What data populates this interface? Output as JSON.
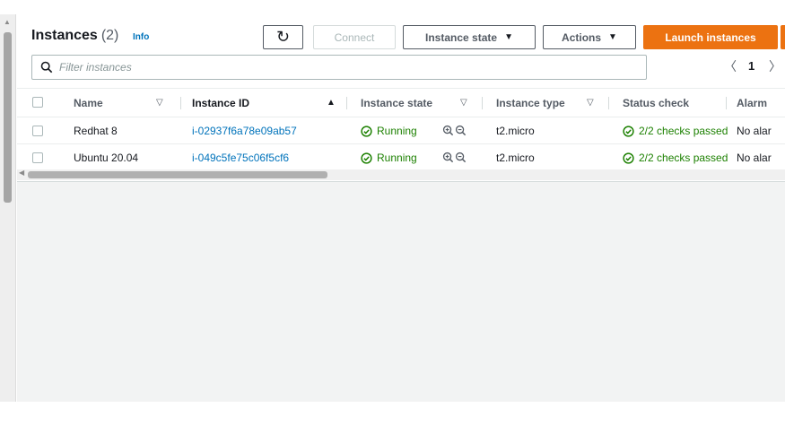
{
  "header": {
    "title": "Instances",
    "count": "(2)",
    "info": "Info"
  },
  "toolbar": {
    "refresh_icon": "refresh-icon",
    "refresh_glyph": "↻",
    "connect": "Connect",
    "instance_state": "Instance state",
    "actions": "Actions",
    "launch": "Launch instances",
    "caret_glyph": "▼"
  },
  "filter": {
    "placeholder": "Filter instances",
    "value": ""
  },
  "pagination": {
    "prev": "〈",
    "page": "1",
    "next": "〉"
  },
  "table": {
    "columns": {
      "name": "Name",
      "instance_id": "Instance ID",
      "instance_state": "Instance state",
      "instance_type": "Instance type",
      "status_check": "Status check",
      "alarm": "Alarm"
    },
    "sort_glyph": "▽",
    "sort_active_glyph": "▲",
    "rows": [
      {
        "name": "Redhat 8",
        "instance_id": "i-02937f6a78e09ab57",
        "state": "Running",
        "type": "t2.micro",
        "status": "2/2 checks passed",
        "alarm": "No alar"
      },
      {
        "name": "Ubuntu 20.04",
        "instance_id": "i-049c5fe75c06f5cf6",
        "state": "Running",
        "type": "t2.micro",
        "status": "2/2 checks passed",
        "alarm": "No alar"
      }
    ]
  },
  "colors": {
    "accent": "#ec7211",
    "link": "#0073bb",
    "success": "#1d8102"
  }
}
